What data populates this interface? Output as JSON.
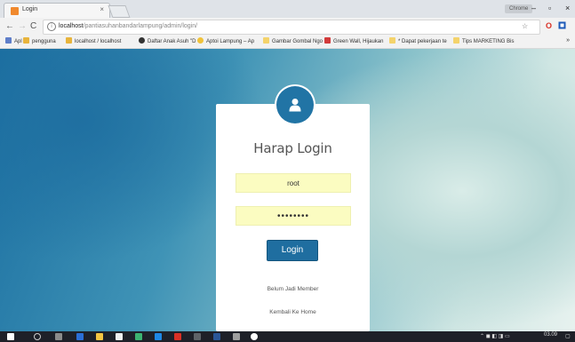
{
  "browser": {
    "tab_title": "Login",
    "tab_close": "×",
    "user_badge": "Chrome",
    "url_host": "localhost",
    "url_path": "/pantiasuhanbandarlampung/admin/login/",
    "bookmarks": [
      {
        "label": "Apl",
        "color": "#5f7ec9"
      },
      {
        "label": "pengguna",
        "color": "#e8b43c"
      },
      {
        "label": "localhost / localhost",
        "color": "#e8b43c"
      },
      {
        "label": "Daftar Anak Asuh \"D",
        "color": "#333333"
      },
      {
        "label": "Aptoi Lampung – Ap",
        "color": "#f0c23a"
      },
      {
        "label": "Gambar Gombal Ngo",
        "color": "#f4d36b"
      },
      {
        "label": "Green Wall, Hijaukan",
        "color": "#d23b3b"
      },
      {
        "label": "* Dapat pekerjaan te",
        "color": "#f4d36b"
      },
      {
        "label": "Tips MARKETING Bis",
        "color": "#f4d36b"
      }
    ],
    "bookmarks_more": "»"
  },
  "login": {
    "title": "Harap Login",
    "username_value": "root",
    "password_value": "••••••••",
    "button_label": "Login",
    "link_member": "Belum Jadi Member",
    "link_home": "Kembali Ke Home"
  },
  "taskbar": {
    "time": "03.09",
    "accent_colors": [
      "#ffffff",
      "#8b8b8b",
      "#8b8b8b",
      "#2b6fd6",
      "#f5c542",
      "#f0f0f0",
      "#3cb371",
      "#1e88e5",
      "#d93025",
      "#5f6368",
      "#2b5797",
      "#9e9e9e",
      "#ffffff"
    ]
  },
  "colors": {
    "accent_blue": "#1f6ea0",
    "field_yellow": "#fbfcc1"
  }
}
